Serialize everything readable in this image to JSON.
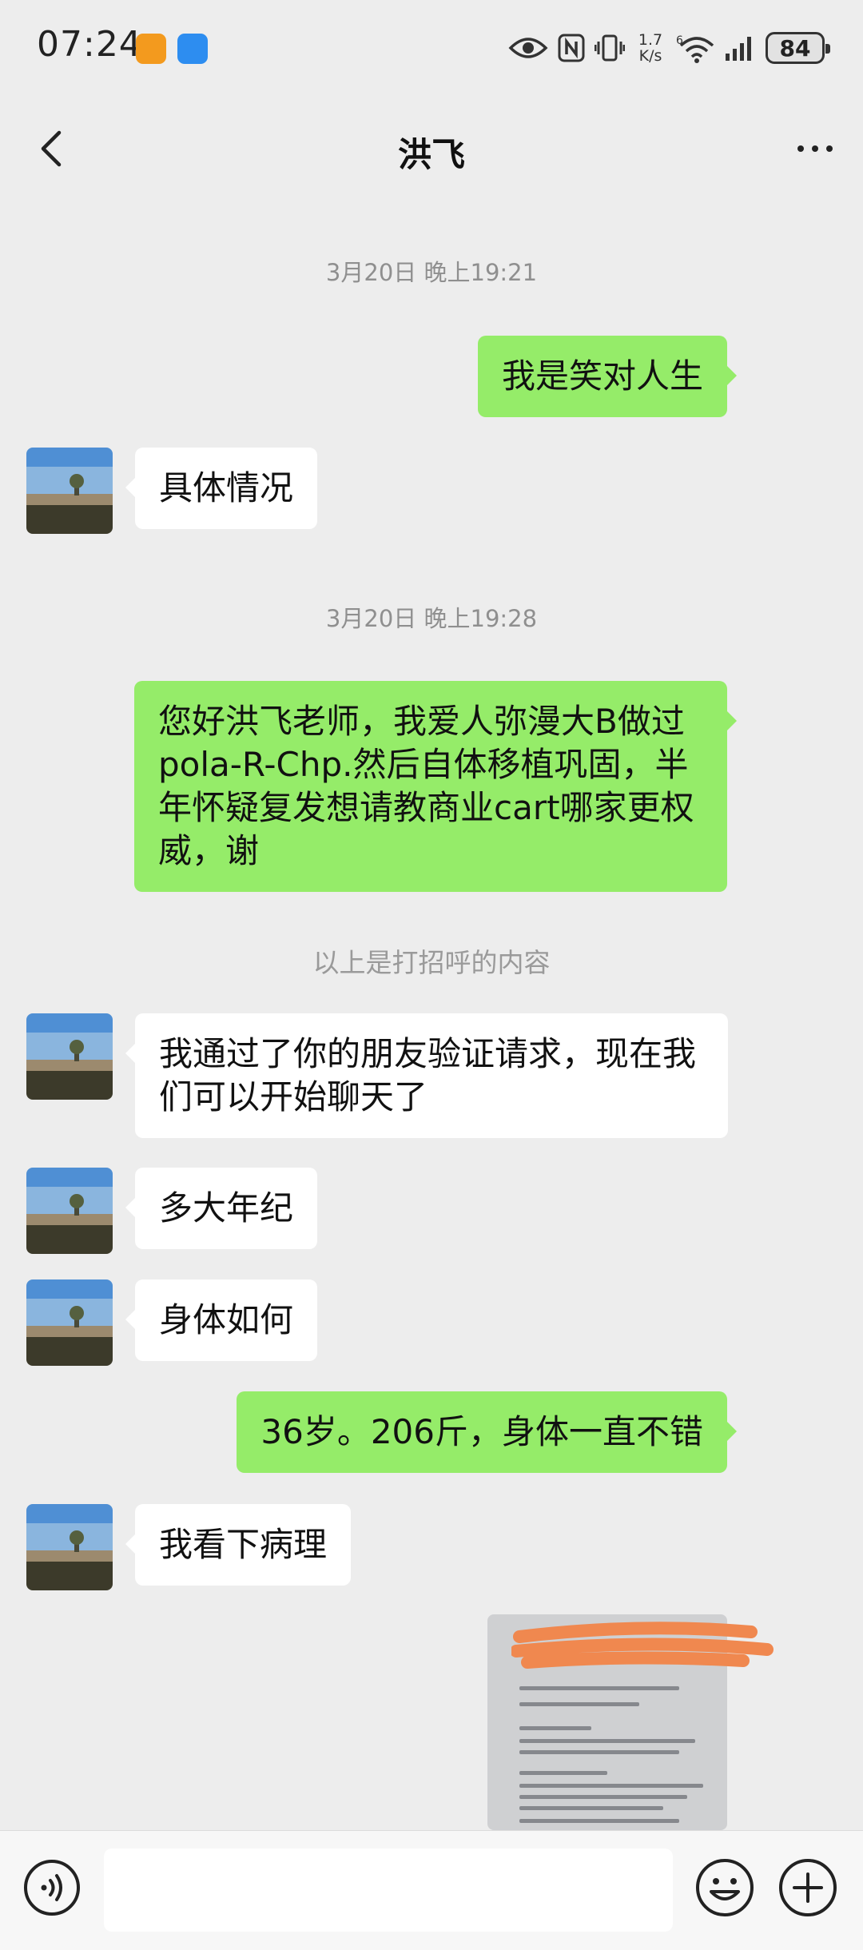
{
  "status_bar": {
    "time": "07:24",
    "net_speed_value": "1.7",
    "net_speed_unit": "K/s",
    "signal_label": "6",
    "battery": "84"
  },
  "nav": {
    "title": "洪飞",
    "back_icon": "chevron-left-icon",
    "more_icon": "more-dots-icon"
  },
  "messages": [
    {
      "type": "timestamp",
      "text": "3月20日 晚上19:21"
    },
    {
      "type": "out",
      "text": "我是笑对人生"
    },
    {
      "type": "in",
      "text": "具体情况"
    },
    {
      "type": "timestamp",
      "text": "3月20日 晚上19:28"
    },
    {
      "type": "out",
      "text": "您好洪飞老师，我爱人弥漫大B做过pola-R-Chp.然后自体移植巩固，半年怀疑复发想请教商业cart哪家更权威，谢"
    },
    {
      "type": "system",
      "text": "以上是打招呼的内容"
    },
    {
      "type": "in",
      "text": "我通过了你的朋友验证请求，现在我们可以开始聊天了"
    },
    {
      "type": "in",
      "text": "多大年纪"
    },
    {
      "type": "in",
      "text": "身体如何"
    },
    {
      "type": "out",
      "text": "36岁。206斤，身体一直不错"
    },
    {
      "type": "in",
      "text": "我看下病理"
    },
    {
      "type": "out-image",
      "text": ""
    }
  ],
  "input_bar": {
    "voice_icon": "voice-icon",
    "emoji_icon": "emoji-icon",
    "plus_icon": "plus-icon",
    "placeholder": ""
  },
  "colors": {
    "background": "#ededed",
    "outgoing_bubble": "#95ec69",
    "incoming_bubble": "#ffffff",
    "timestamp_text": "#8f8f8f"
  }
}
